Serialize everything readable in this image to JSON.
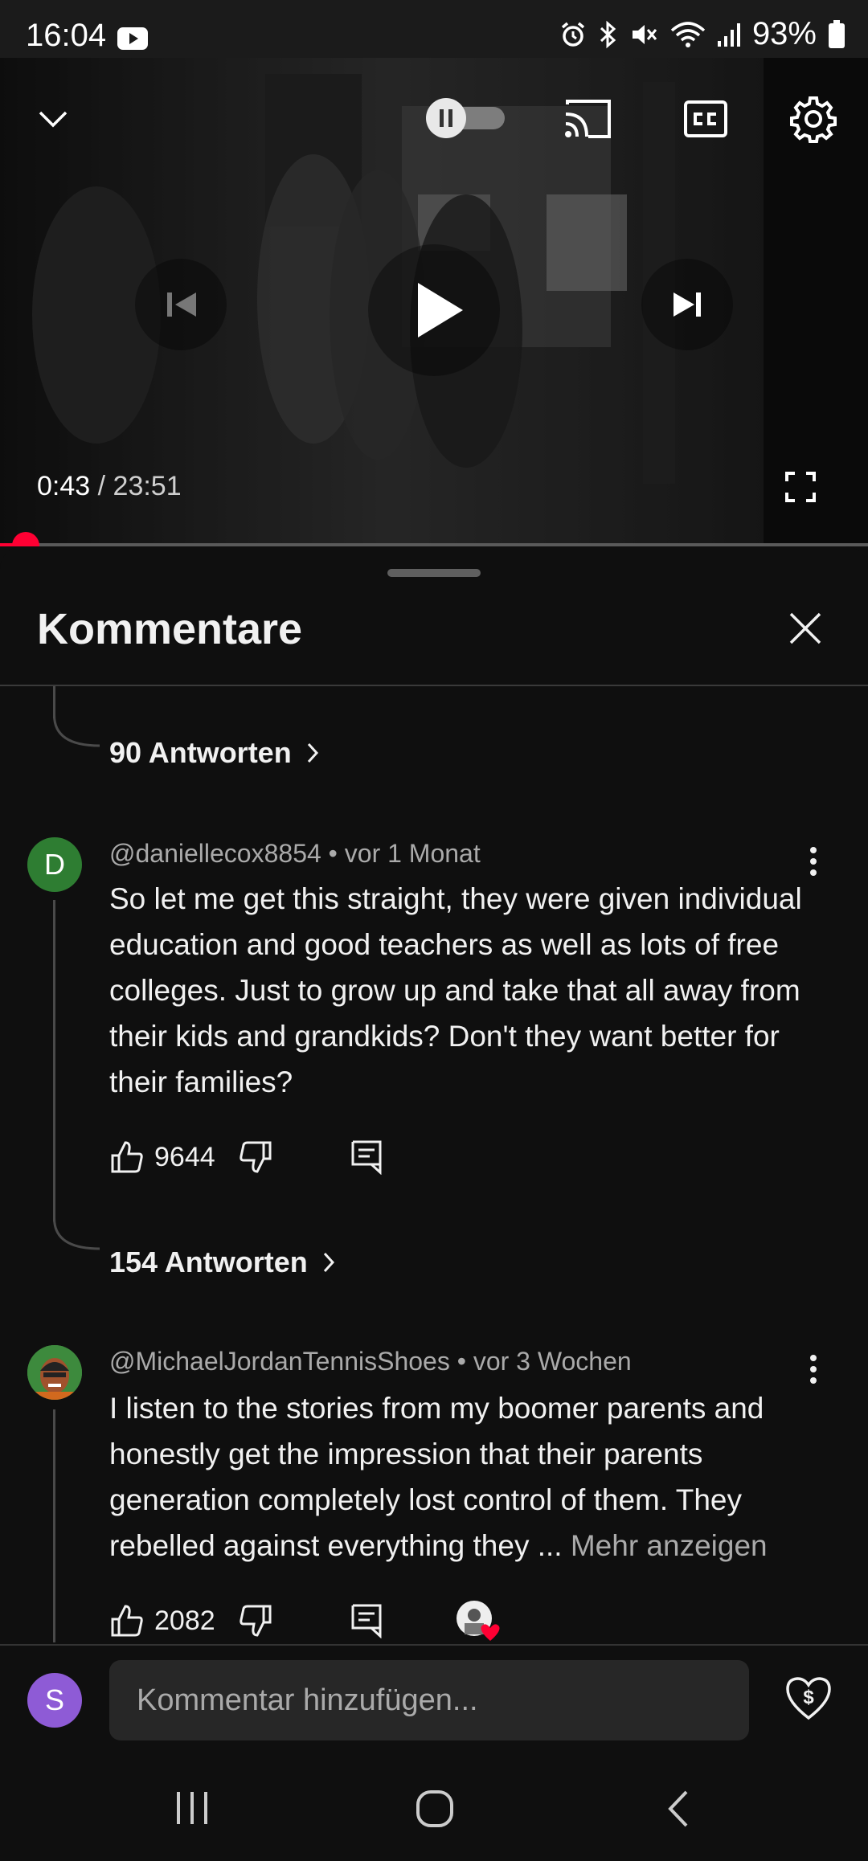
{
  "status_bar": {
    "time": "16:04",
    "battery": "93%",
    "icons": [
      "youtube-icon",
      "alarm-icon",
      "bluetooth-icon",
      "mute-icon",
      "wifi-icon",
      "signal-icon",
      "battery-icon"
    ]
  },
  "player": {
    "time_current": "0:43",
    "time_separator": "/",
    "time_total": "23:51",
    "progress_fraction": 0.03,
    "icons": [
      "chevron-down-icon",
      "autoplay-toggle-icon",
      "cast-icon",
      "captions-icon",
      "settings-gear-icon",
      "previous-icon",
      "play-icon",
      "next-icon",
      "fullscreen-icon"
    ]
  },
  "comments": {
    "title": "Kommentare",
    "first_replies": "90 Antworten",
    "items": [
      {
        "author": "@daniellecox8854",
        "age": "vor 1 Monat",
        "avatar_letter": "D",
        "avatar_color": "#2e7d32",
        "text": "So let me get this straight, they were given individual education and good teachers as well as lots of free colleges. Just to grow up and take that all away from their kids and grandkids? Don't they want better for their families?",
        "more_label": "",
        "likes": "9644",
        "replies": "154 Antworten"
      },
      {
        "author": "@MichaelJordanTennisShoes",
        "age": "vor 3 Wochen",
        "avatar_letter": "",
        "avatar_color": "#3a7a3a",
        "text": "I listen to the stories from my boomer parents and honestly get the impression that their parents generation completely lost control of them. They rebelled against everything they ...",
        "more_label": "Mehr anzeigen",
        "likes": "2082",
        "replies": ""
      }
    ],
    "meta_separator": "•"
  },
  "composer": {
    "avatar_letter": "S",
    "avatar_color": "#8e5bd6",
    "placeholder": "Kommentar hinzufügen..."
  },
  "accent_color": "#ff0033"
}
